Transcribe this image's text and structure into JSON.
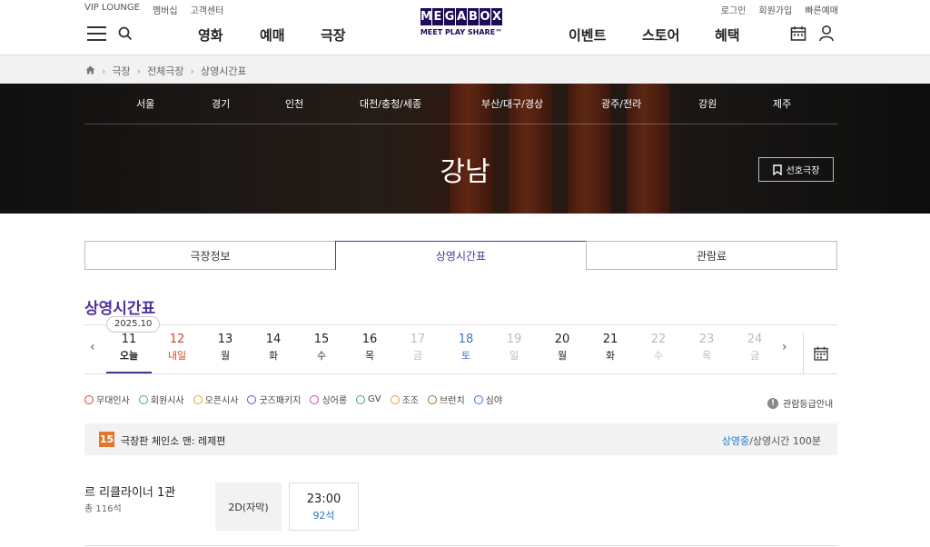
{
  "header": {
    "util_left": [
      "VIP LOUNGE",
      "멤버십",
      "고객센터"
    ],
    "util_right": [
      "로그인",
      "회원가입",
      "빠른예매"
    ],
    "logo_letters": [
      "M",
      "E",
      "G",
      "A",
      "B",
      "O",
      "X"
    ],
    "logo_sub": "MEET PLAY SHARE™",
    "nav_left": [
      "영화",
      "예매",
      "극장"
    ],
    "nav_right": [
      "이벤트",
      "스토어",
      "혜택"
    ]
  },
  "breadcrumb": [
    "극장",
    "전체극장",
    "상영시간표"
  ],
  "hero": {
    "regions": [
      "서울",
      "경기",
      "인천",
      "대전/충청/세종",
      "부산/대구/경상",
      "광주/전라",
      "강원",
      "제주"
    ],
    "theater": "강남",
    "favorite": "선호극장"
  },
  "tabs": [
    "극장정보",
    "상영시간표",
    "관람료"
  ],
  "section_title": "상영시간표",
  "date_strip": {
    "year_month": "2025.10",
    "days": [
      {
        "d": "11",
        "w": "오늘",
        "color": "#222222",
        "selected": true
      },
      {
        "d": "12",
        "w": "내일",
        "color": "#d0452b",
        "selected": false
      },
      {
        "d": "13",
        "w": "월",
        "color": "#222222",
        "selected": false
      },
      {
        "d": "14",
        "w": "화",
        "color": "#222222",
        "selected": false
      },
      {
        "d": "15",
        "w": "수",
        "color": "#222222",
        "selected": false
      },
      {
        "d": "16",
        "w": "목",
        "color": "#222222",
        "selected": false
      },
      {
        "d": "17",
        "w": "금",
        "color": "#bbbbbb",
        "selected": false
      },
      {
        "d": "18",
        "w": "토",
        "color": "#3b76c4",
        "selected": false
      },
      {
        "d": "19",
        "w": "일",
        "color": "#bbbbbb",
        "selected": false
      },
      {
        "d": "20",
        "w": "월",
        "color": "#222222",
        "selected": false
      },
      {
        "d": "21",
        "w": "화",
        "color": "#222222",
        "selected": false
      },
      {
        "d": "22",
        "w": "수",
        "color": "#bbbbbb",
        "selected": false
      },
      {
        "d": "23",
        "w": "목",
        "color": "#bbbbbb",
        "selected": false
      },
      {
        "d": "24",
        "w": "금",
        "color": "#bbbbbb",
        "selected": false
      }
    ]
  },
  "legend": [
    {
      "label": "무대인사",
      "color": "#d0452b"
    },
    {
      "label": "회원시사",
      "color": "#3b9fd8"
    },
    {
      "label": "오픈시사",
      "color": "#e8a020"
    },
    {
      "label": "굿즈패키지",
      "color": "#7a4bc4"
    },
    {
      "label": "싱어롱",
      "color": "#c050a8"
    },
    {
      "label": "GV",
      "color": "#3aa86a"
    },
    {
      "label": "조조",
      "color": "#e0a030"
    },
    {
      "label": "브런치",
      "color": "#a86a30"
    },
    {
      "label": "심야",
      "color": "#3a7ac8"
    }
  ],
  "grade_info": "관람등급안내",
  "movie": {
    "rating": "15",
    "title": "극장판 체인소 맨: 레제편",
    "status": "상영중",
    "runtime": "/상영시간 100분"
  },
  "hall": {
    "name": "르 리클라이너 1관",
    "seats": "총 116석",
    "format": "2D(자막)",
    "time": "23:00",
    "remaining": "92석"
  }
}
